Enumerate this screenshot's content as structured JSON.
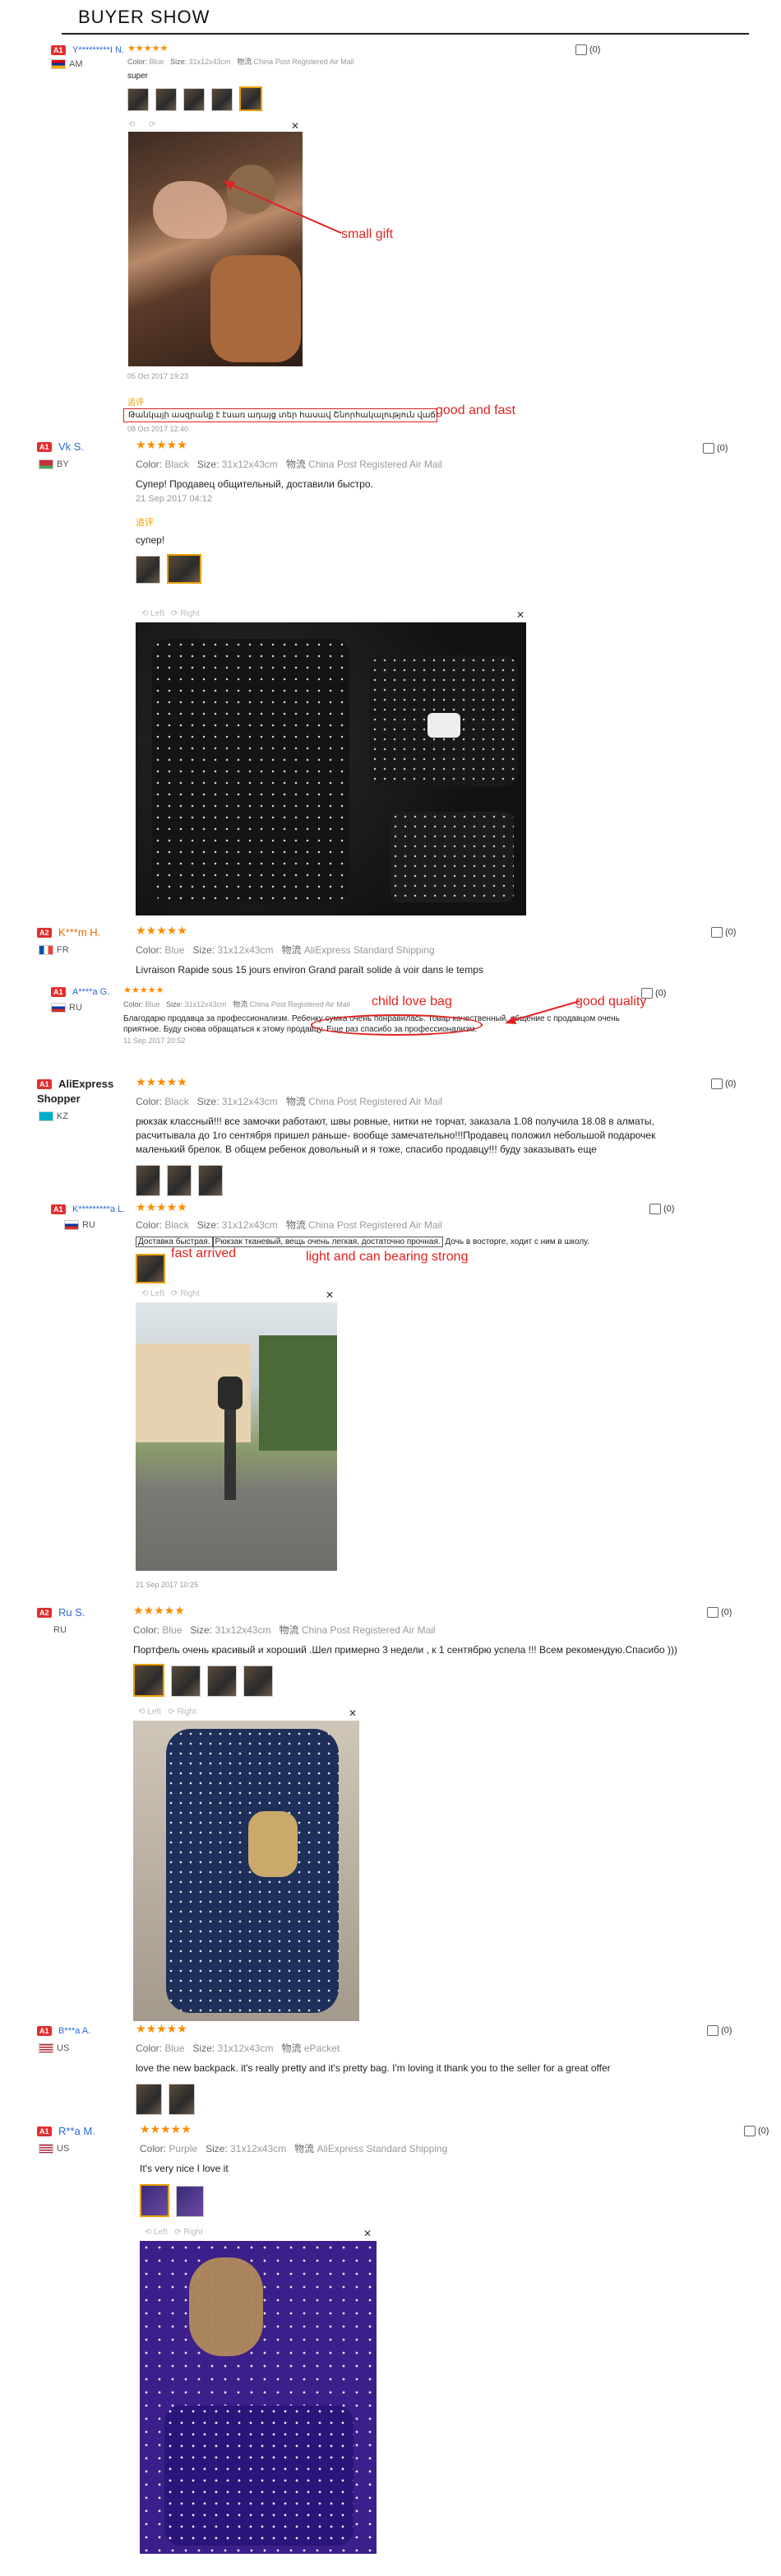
{
  "header": {
    "title": "BUYER SHOW"
  },
  "reviews": [
    {
      "badge": "A1",
      "name": "Y*********I N.",
      "country": "AM",
      "stars": "★★★★★",
      "color_label": "Color:",
      "color": "Blue",
      "size_label": "Size:",
      "size": "31x12x43cm",
      "ship_icon": "物流",
      "shipping": "China Post Registered Air Mail",
      "text": "super",
      "date": "05 Oct 2017 19:23",
      "followup_icon": "追评",
      "followup_text": "Թանկայի ասզրանք է էսառ ադայց տեր հասավ Շնորհակալություն վաճառողին։",
      "followup_date": "08 Oct 2017 12:40",
      "helpful": "(0)"
    },
    {
      "badge": "A1",
      "name": "Vk S.",
      "country": "BY",
      "stars": "★★★★★",
      "color_label": "Color:",
      "color": "Black",
      "size_label": "Size:",
      "size": "31x12x43cm",
      "ship_icon": "物流",
      "shipping": "China Post Registered Air Mail",
      "text": "Супер! Продавец общительный, доставили быстро.",
      "date": "21 Sep 2017 04:12",
      "followup_icon": "追评",
      "followup_text": "супер!",
      "helpful": "(0)",
      "viewer_left": "Left",
      "viewer_right": "Right"
    },
    {
      "badge": "A2",
      "name": "K***m H.",
      "country": "FR",
      "stars": "★★★★★",
      "color_label": "Color:",
      "color": "Blue",
      "size_label": "Size:",
      "size": "31x12x43cm",
      "ship_icon": "物流",
      "shipping": "AliExpress Standard Shipping",
      "text": "Livraison Rapide sous 15 jours environ Grand paraît solide à voir dans le temps",
      "helpful": "(0)"
    },
    {
      "badge": "A1",
      "name": "A****a G.",
      "country": "RU",
      "stars": "★★★★★",
      "color_label": "Color:",
      "color": "Blue",
      "size_label": "Size:",
      "size": "31x12x43cm",
      "ship_icon": "物流",
      "shipping": "China Post Registered Air Mail",
      "text": "Благодарю продавца за профессионализм. Ребенку сумка очень понравилась. Товар качественный, общение с продавцом очень приятное. Буду снова обращаться к этому продавцу. Еще раз спасибо за профессионализм.",
      "date": "11 Sep 2017 20:52",
      "helpful": "(0)"
    },
    {
      "badge": "A1",
      "name": "AliExpress Shopper",
      "country": "KZ",
      "stars": "★★★★★",
      "color_label": "Color:",
      "color": "Black",
      "size_label": "Size:",
      "size": "31x12x43cm",
      "ship_icon": "物流",
      "shipping": "China Post Registered Air Mail",
      "text": "рюкзак классный!!! все замочки работают, швы ровные, нитки не торчат, заказала 1.08 получила 18.08 в алматы, расчитывала до 1го сентября пришел раньше- вообще замечательно!!!Продавец положил небольшой подарочек маленький брелок. В общем ребенок довольный и я тоже, спасибо продавцу!!! буду заказывать еще",
      "helpful": "(0)"
    },
    {
      "badge": "A1",
      "name": "K*********a L.",
      "country": "RU",
      "stars": "★★★★★",
      "color_label": "Color:",
      "color": "Black",
      "size_label": "Size:",
      "size": "31x12x43cm",
      "ship_icon": "物流",
      "shipping": "China Post Registered Air Mail",
      "text_a": "Доставка быстрая.",
      "text_b": "Рюкзак тканевый, вещь очень легкая, достаточно прочная.",
      "text_c": "Дочь в восторге, ходит с ним в школу.",
      "date": "21 Sep 2017 10:25",
      "helpful": "(0)",
      "viewer_left": "Left",
      "viewer_right": "Right"
    },
    {
      "badge": "A2",
      "name": "Ru S.",
      "country": "RU",
      "stars": "★★★★★",
      "color_label": "Color:",
      "color": "Blue",
      "size_label": "Size:",
      "size": "31x12x43cm",
      "ship_icon": "物流",
      "shipping": "China Post Registered Air Mail",
      "text": "Портфель очень красивый и хороший .Шел примерно 3 недели , к 1 сентябрю успела !!! Всем рекомендую.Спасибо )))",
      "helpful": "(0)",
      "viewer_left": "Left",
      "viewer_right": "Right"
    },
    {
      "badge": "A1",
      "name": "B***a A.",
      "country": "US",
      "stars": "★★★★★",
      "color_label": "Color:",
      "color": "Blue",
      "size_label": "Size:",
      "size": "31x12x43cm",
      "ship_icon": "物流",
      "shipping": "ePacket",
      "text": "love the new backpack. it's really pretty and it's pretty bag. I'm loving it thank you to the seller for a great offer",
      "helpful": "(0)"
    },
    {
      "badge": "A1",
      "name": "R**a M.",
      "country": "US",
      "stars": "★★★★★",
      "color_label": "Color:",
      "color": "Purple",
      "size_label": "Size:",
      "size": "31x12x43cm",
      "ship_icon": "物流",
      "shipping": "AliExpress Standard Shipping",
      "text": "It's very nice I love it",
      "helpful": "(0)",
      "viewer_left": "Left",
      "viewer_right": "Right"
    }
  ],
  "annotations": {
    "small_gift": "small gift",
    "good_and_fast": "good and fast",
    "child_love_bag": "child love bag",
    "good_quality": "good quality",
    "fast_arrived": "fast arrived",
    "light_strong": "light and can bearing strong"
  },
  "colors": {
    "accent_red": "#e02222",
    "star_orange": "#ff8a00",
    "link_blue": "#2a6ad6"
  }
}
